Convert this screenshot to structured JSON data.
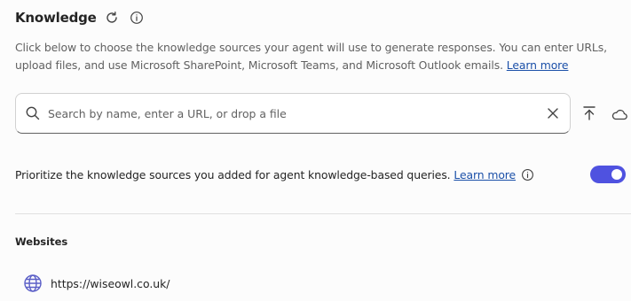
{
  "header": {
    "title": "Knowledge",
    "refresh_icon": "refresh-icon",
    "info_icon": "info-icon"
  },
  "description": {
    "text": "Click below to choose the knowledge sources your agent will use to generate responses. You can enter URLs, upload files, and use Microsoft SharePoint, Microsoft Teams, and Microsoft Outlook emails.",
    "link": "Learn more"
  },
  "search": {
    "placeholder": "Search by name, enter a URL, or drop a file",
    "value": "",
    "search_icon": "search-icon",
    "clear_icon": "close-icon"
  },
  "actions": {
    "upload_icon": "upload-icon",
    "cloud_icon": "cloud-icon"
  },
  "prioritize": {
    "text": "Prioritize the knowledge sources you added for agent knowledge-based queries.",
    "link": "Learn more",
    "info_icon": "info-icon",
    "toggle_on": true
  },
  "websites": {
    "title": "Websites",
    "items": [
      {
        "url": "https://wiseowl.co.uk/",
        "icon": "globe-icon"
      }
    ]
  },
  "colors": {
    "accent": "#4f52e0",
    "link": "#1a4fa8",
    "globe": "#5b5fc7",
    "text": "#242424",
    "muted": "#616161"
  }
}
